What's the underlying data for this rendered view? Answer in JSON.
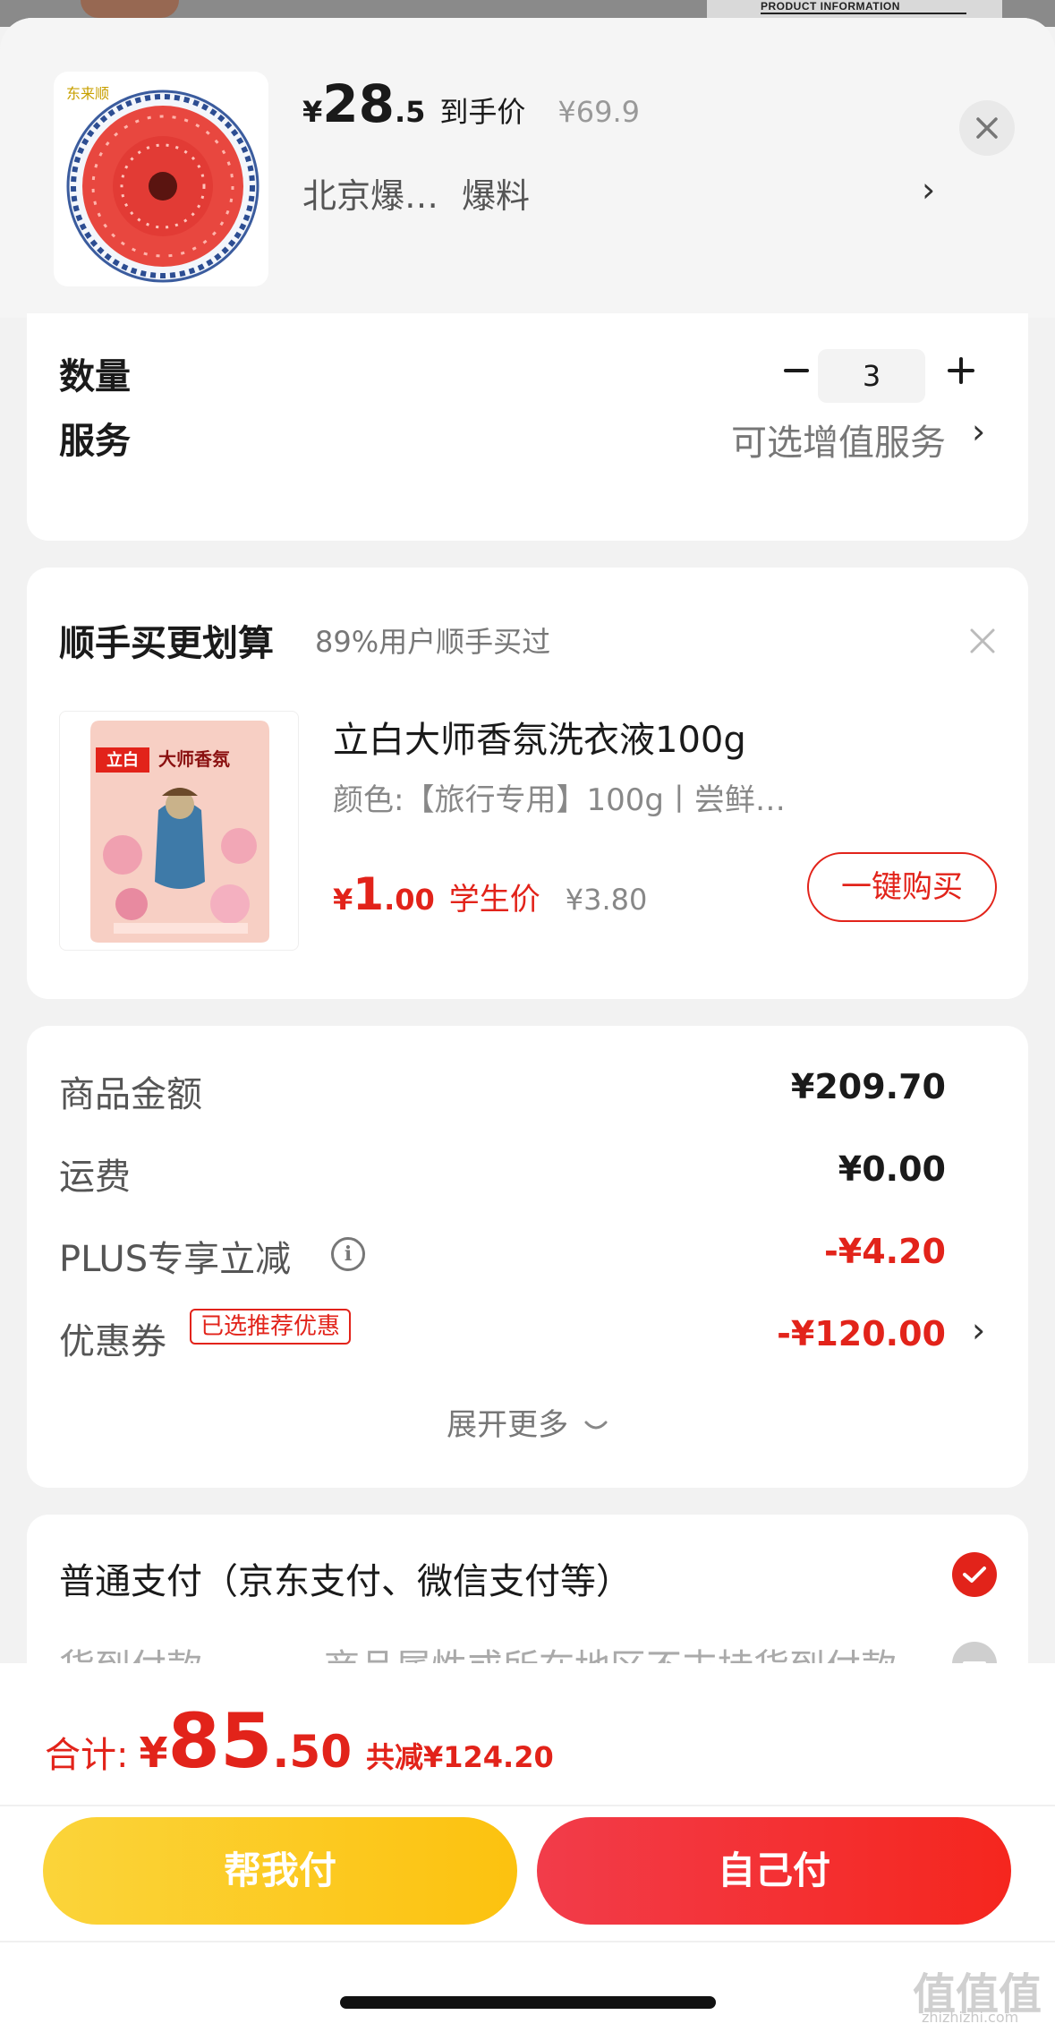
{
  "backdrop": {
    "right_text": "PRODUCT INFORMATION"
  },
  "product": {
    "price_yen": "¥",
    "price_int": "28",
    "price_dec": ".5",
    "price_label": "到手价",
    "original_price": "¥69.9",
    "name": "北京爆…",
    "tag": "爆料",
    "logo_text": "东来顺"
  },
  "quantity": {
    "label": "数量",
    "value": "3"
  },
  "service": {
    "label": "服务",
    "value": "可选增值服务"
  },
  "recommend": {
    "title": "顺手买更划算",
    "subtitle": "89%用户顺手买过",
    "item_name": "立白大师香氛洗衣液100g",
    "item_spec": "颜色:【旅行专用】100g丨尝鲜…",
    "price_yen": "¥",
    "price_int": "1",
    "price_dec": ".00",
    "price_label": "学生价",
    "original_price": "¥3.80",
    "buy_label": "一键购买",
    "pack_brand": "立白",
    "pack_title": "大师香氛"
  },
  "summary": {
    "rows": [
      {
        "label": "商品金额",
        "value": "¥209.70"
      },
      {
        "label": "运费",
        "value": "¥0.00"
      },
      {
        "label": "PLUS专享立减",
        "value": "-¥4.20"
      },
      {
        "label": "优惠券",
        "value": "-¥120.00",
        "badge": "已选推荐优惠"
      }
    ],
    "expand_label": "展开更多"
  },
  "payment": {
    "normal": "普通支付（京东支付、微信支付等）",
    "cod": "货到付款",
    "cod_note": "商品属性或所在地区不支持货到付款"
  },
  "footer": {
    "total_label": "合计:",
    "total_yen": "¥",
    "total_int": "85",
    "total_dec": ".50",
    "saved": "共减¥124.20",
    "help_pay": "帮我付",
    "self_pay": "自己付"
  },
  "watermark": {
    "text": "值值值",
    "url": "zhizhizhi.com"
  },
  "colors": {
    "accent_red": "#e2231a",
    "help_yellow": "#fcc20f",
    "self_red": "#f5261e"
  }
}
